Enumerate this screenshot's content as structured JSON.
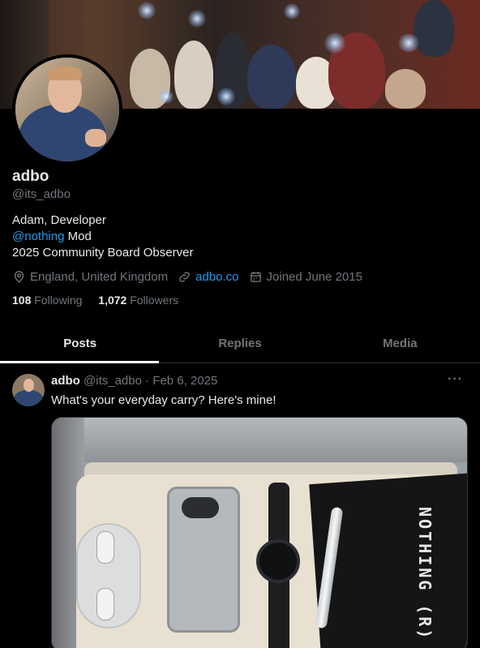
{
  "profile": {
    "name": "adbo",
    "handle": "@its_adbo",
    "bio_line1": "Adam, Developer",
    "bio_mention": "@nothing",
    "bio_mention_suffix": " Mod",
    "bio_line3": "2025 Community Board Observer",
    "location": "England, United Kingdom",
    "website": "adbo.co",
    "joined": "Joined June 2015",
    "following_count": "108",
    "following_label": "Following",
    "followers_count": "1,072",
    "followers_label": "Followers"
  },
  "tabs": [
    {
      "label": "Posts",
      "active": true
    },
    {
      "label": "Replies",
      "active": false
    },
    {
      "label": "Media",
      "active": false
    }
  ],
  "post": {
    "author": "adbo",
    "handle_date": "@its_adbo · Feb 6, 2025",
    "more": "···",
    "text": "What's your everyday carry? Here's mine!",
    "image_text": "NOTHING (R)"
  },
  "colors": {
    "background": "#000000",
    "text": "#e7e9ea",
    "muted": "#71767b",
    "link": "#1d9bf0",
    "divider": "#2f3336"
  },
  "icons": {
    "location": "location-pin-icon",
    "website": "link-icon",
    "joined": "calendar-icon",
    "more": "more-options-icon"
  }
}
